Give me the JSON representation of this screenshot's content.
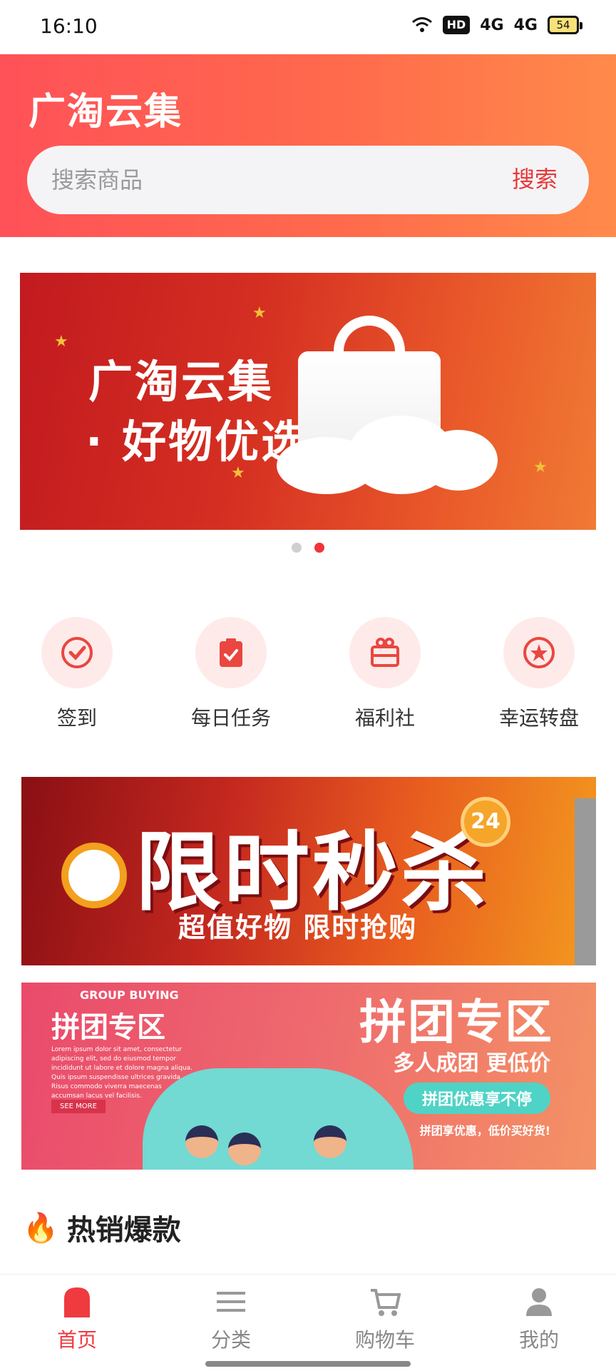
{
  "status_bar": {
    "time": "16:10",
    "signal_1": "4G",
    "signal_2": "4G",
    "hd": "HD",
    "battery": "54"
  },
  "header": {
    "title": "广淘云集",
    "search_placeholder": "搜索商品",
    "search_button": "搜索"
  },
  "banner": {
    "line1": "广淘云集",
    "line2": "· 好物优选",
    "dots": 2,
    "active_dot": 2
  },
  "quick_menu": [
    {
      "label": "签到",
      "icon": "check-circle-icon"
    },
    {
      "label": "每日任务",
      "icon": "clipboard-check-icon"
    },
    {
      "label": "福利社",
      "icon": "gift-icon"
    },
    {
      "label": "幸运转盘",
      "icon": "star-circle-icon"
    }
  ],
  "flash_sale": {
    "title": "限时秒杀",
    "subtitle": "超值好物  限时抢购",
    "badge": "24"
  },
  "group_buying": {
    "en_label": "GROUP BUYING",
    "left_title": "拼团专区",
    "lorem": "Lorem ipsum dolor sit amet, consectetur adipiscing elit, sed do eiusmod tempor incididunt ut labore et dolore magna aliqua. Quis ipsum suspendisse ultrices gravida. Risus commodo viverra maecenas accumsan lacus vel facilisis.",
    "see_more": "SEE MORE",
    "title": "拼团专区",
    "subtitle": "多人成团 更低价",
    "pill": "拼团优惠享不停",
    "small": "拼团享优惠，低价买好货!"
  },
  "section": {
    "title": "热销爆款"
  },
  "tabs": [
    {
      "label": "首页",
      "icon": "home-icon",
      "active": true
    },
    {
      "label": "分类",
      "icon": "menu-icon",
      "active": false
    },
    {
      "label": "购物车",
      "icon": "cart-icon",
      "active": false
    },
    {
      "label": "我的",
      "icon": "user-icon",
      "active": false
    }
  ],
  "colors": {
    "brand": "#ef3a40",
    "header_start": "#ff5158",
    "header_end": "#ff8a4a"
  }
}
